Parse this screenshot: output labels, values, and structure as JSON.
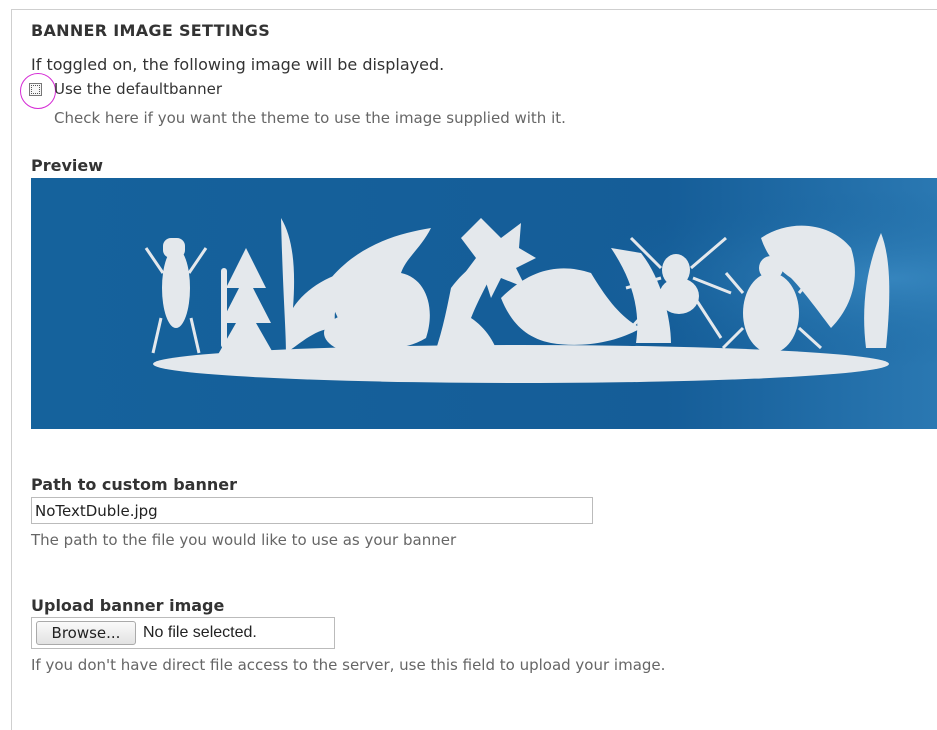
{
  "section": {
    "title": "BANNER IMAGE SETTINGS"
  },
  "intro_text": "If toggled on, the following image will be displayed.",
  "default_banner": {
    "label": "Use the defaultbanner",
    "checked": false,
    "description": "Check here if you want the theme to use the image supplied with it."
  },
  "preview": {
    "label": "Preview",
    "background_color": "#15629c",
    "silhouette_color": "#e4e8ec"
  },
  "custom_path": {
    "label": "Path to custom banner",
    "value": "NoTextDuble.jpg",
    "description": "The path to the file you would like to use as your banner"
  },
  "upload": {
    "label": "Upload banner image",
    "button_label": "Browse...",
    "status": "No file selected.",
    "description": "If you don't have direct file access to the server, use this field to upload your image."
  },
  "colors": {
    "focus_ring": "#d52ad5"
  }
}
